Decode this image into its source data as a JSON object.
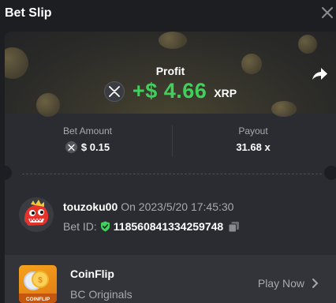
{
  "header": {
    "title": "Bet Slip",
    "close_icon": "close-icon"
  },
  "result": {
    "profit_label": "Profit",
    "profit_value": "+$ 4.66",
    "currency": "XRP",
    "profit_color": "#3fd15b",
    "share_icon": "share-icon"
  },
  "stats": {
    "bet_amount_label": "Bet Amount",
    "bet_amount_value": "$ 0.15",
    "payout_label": "Payout",
    "payout_value": "31.68 x"
  },
  "bet": {
    "username": "touzoku00",
    "datetime": "On 2023/5/20 17:45:30",
    "bet_id_label": "Bet ID:",
    "bet_id": "118560841334259748"
  },
  "game": {
    "name": "CoinFlip",
    "provider": "BC Originals",
    "thumb_label": "COINFLIP",
    "play_label": "Play Now"
  }
}
